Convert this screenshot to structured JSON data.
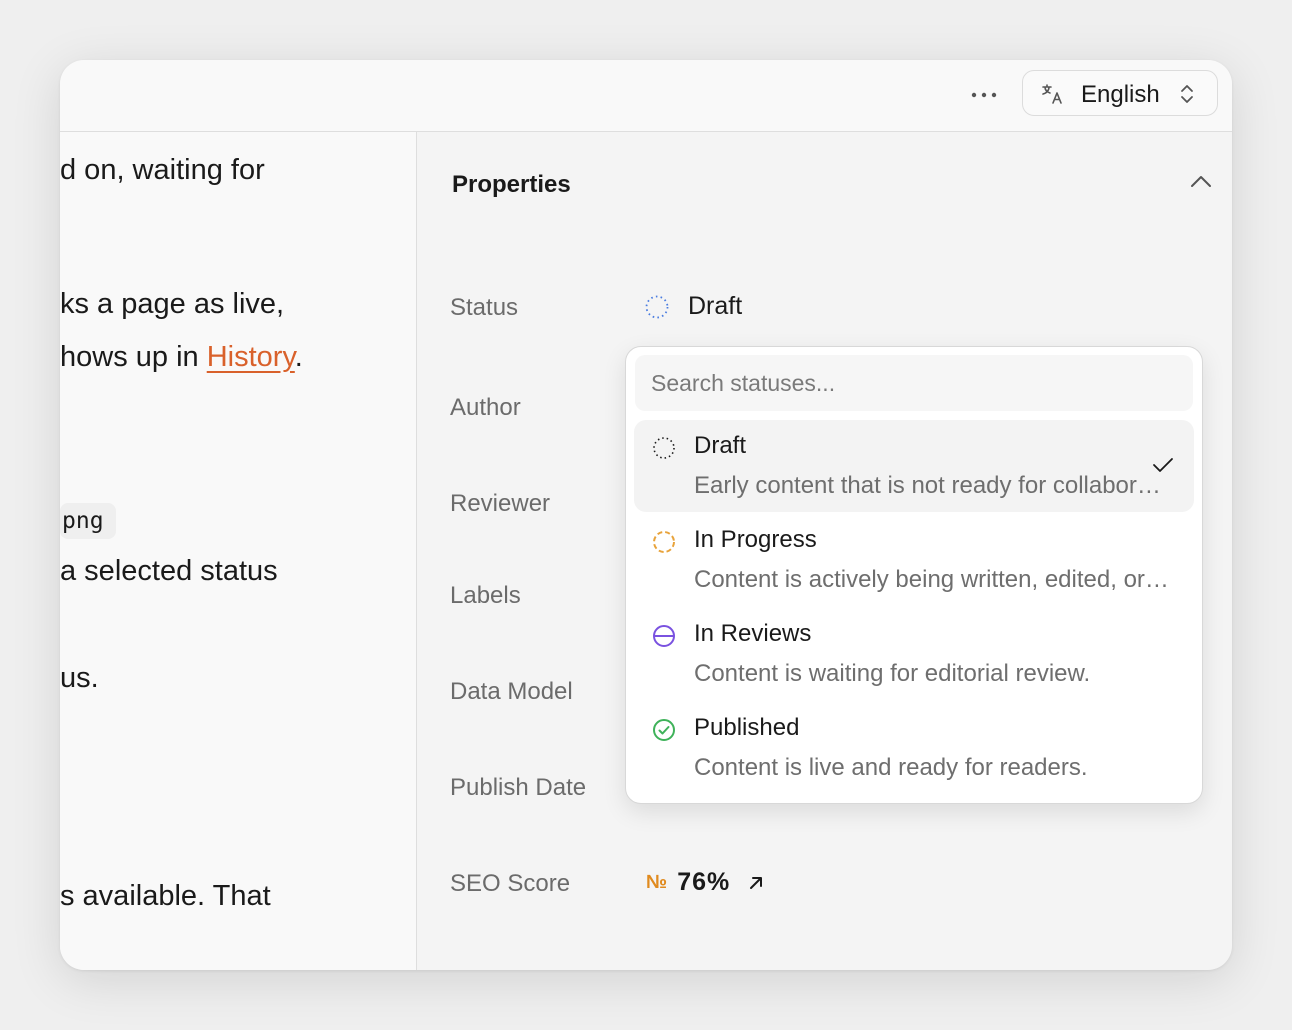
{
  "topbar": {
    "more_icon": "ellipsis-icon",
    "language_label": "English",
    "language_icon": "translate-icon"
  },
  "left_pane": {
    "lines": [
      "d on, waiting for",
      "ks a page as live,",
      "hows up in",
      "History",
      ".",
      "png",
      "a selected status",
      "us.",
      "s available. That"
    ],
    "link_color": "#d9612b"
  },
  "properties": {
    "title": "Properties",
    "labels": {
      "status": "Status",
      "author": "Author",
      "reviewer": "Reviewer",
      "labels": "Labels",
      "data_model": "Data Model",
      "publish_date": "Publish Date",
      "seo_score": "SEO Score"
    },
    "status_value": "Draft",
    "seo": {
      "prefix": "№",
      "value": "76%"
    }
  },
  "status_popup": {
    "search_placeholder": "Search statuses...",
    "options": [
      {
        "name": "Draft",
        "description": "Early content that is not ready for collaboration.",
        "icon": "dotted-circle-icon",
        "color": "#1a1a1a",
        "selected": true
      },
      {
        "name": "In Progress",
        "description": "Content is actively being written, edited, or updated.",
        "icon": "dashed-circle-icon",
        "color": "#e8a33b",
        "selected": false
      },
      {
        "name": "In Reviews",
        "description": "Content is waiting for editorial review.",
        "icon": "half-circle-icon",
        "color": "#7a52e0",
        "selected": false
      },
      {
        "name": "Published",
        "description": "Content is live and ready for readers.",
        "icon": "check-circle-icon",
        "color": "#3fb25a",
        "selected": false
      }
    ]
  }
}
